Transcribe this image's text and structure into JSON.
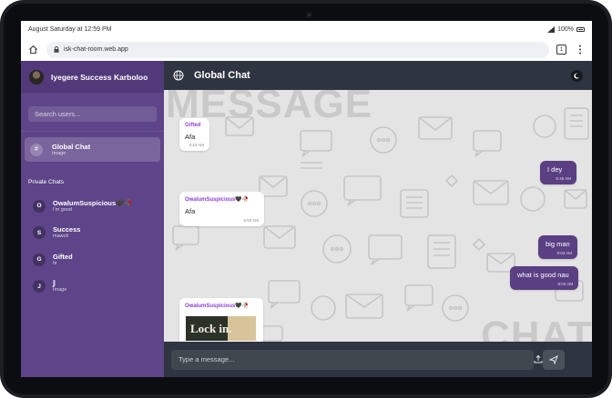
{
  "status_bar": {
    "datetime": "August Saturday at 12:59 PM",
    "battery": "100%"
  },
  "browser": {
    "url": "isk-chat-room.web.app",
    "tab_count": "1"
  },
  "sidebar": {
    "user_name": "Iyegere Success Karboloo",
    "search_placeholder": "Search users...",
    "global_chat": {
      "title": "Global Chat",
      "subtitle": "Image",
      "icon": "#"
    },
    "private_title": "Private Chats",
    "private_chats": [
      {
        "initial": "O",
        "name": "OwalumSuspicious🖤🥀",
        "preview": "I'm good"
      },
      {
        "initial": "S",
        "name": "Success",
        "preview": "mawoli"
      },
      {
        "initial": "G",
        "name": "Gifted",
        "preview": "hi"
      },
      {
        "initial": "J",
        "name": "𝕁",
        "preview": "Image"
      }
    ]
  },
  "main": {
    "title": "Global Chat",
    "background_words": {
      "top": "MESSAGE",
      "bottom": "CHAT"
    },
    "messages": [
      {
        "sender": "Gifted",
        "text": "Afa",
        "time": "3:43 AM",
        "type": "in"
      },
      {
        "sender": "",
        "text": "I dey",
        "time": "5:46 AM",
        "type": "out"
      },
      {
        "sender": "OwalumSuspicious🖤🥀",
        "text": "Afa",
        "time": "6:53 AM",
        "type": "in"
      },
      {
        "sender": "",
        "text": "big man",
        "time": "8:03 AM",
        "type": "out"
      },
      {
        "sender": "",
        "text": "what is good nau",
        "time": "8:04 AM",
        "type": "out"
      },
      {
        "sender": "OwalumSuspicious🖤🥀",
        "image_text": "Lock in.",
        "type": "in"
      }
    ],
    "composer_placeholder": "Type a message..."
  },
  "colors": {
    "sidebar": "#5e4488",
    "header": "#2f3540",
    "outgoing_bubble": "#5a3f83",
    "sender_name": "#8b3fd9"
  },
  "icons": [
    "home-icon",
    "lock-icon",
    "tabs-icon",
    "more-vert-icon",
    "globe-icon",
    "theme-toggle-icon",
    "upload-icon",
    "send-icon"
  ]
}
